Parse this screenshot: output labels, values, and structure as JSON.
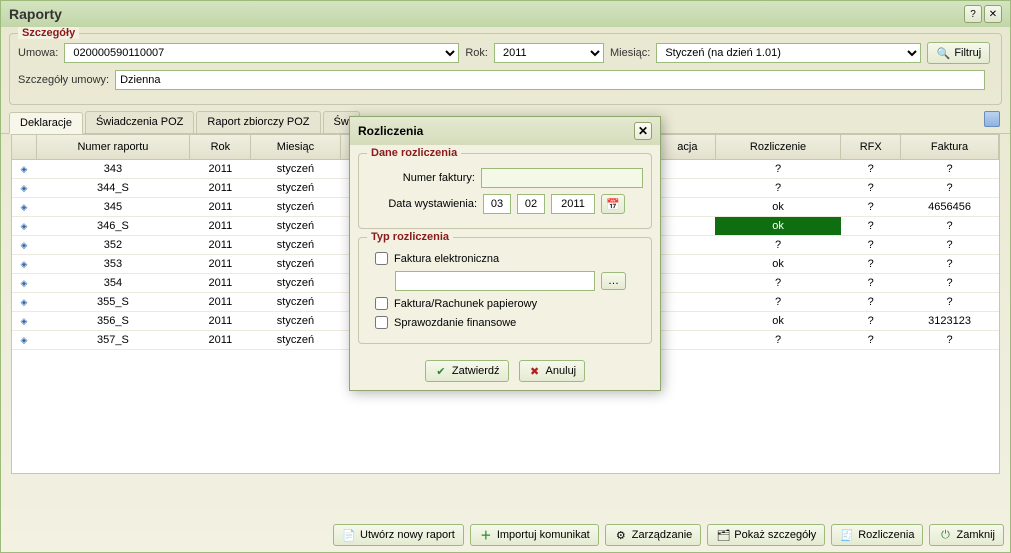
{
  "window": {
    "title": "Raporty"
  },
  "details": {
    "legend": "Szczegóły",
    "contract_label": "Umowa:",
    "contract_value": "020000590110007",
    "year_label": "Rok:",
    "year_value": "2011",
    "month_label": "Miesiąc:",
    "month_value": "Styczeń (na dzień 1.01)",
    "filter_label": "Filtruj",
    "contract_details_label": "Szczegóły umowy:",
    "contract_details_value": "Dzienna"
  },
  "tabs": [
    "Deklaracje",
    "Świadczenia POZ",
    "Raport zbiorczy POZ",
    "Św"
  ],
  "grid": {
    "columns": [
      "",
      "Numer raportu",
      "Rok",
      "Miesiąc",
      "acja",
      "Rozliczenie",
      "RFX",
      "Faktura"
    ],
    "rows": [
      {
        "num": "343",
        "rok": "2011",
        "miesiac": "styczeń",
        "acja": "",
        "roz": "?",
        "roz_hl": false,
        "rfx": "?",
        "faktura": "?"
      },
      {
        "num": "344_S",
        "rok": "2011",
        "miesiac": "styczeń",
        "acja": "",
        "roz": "?",
        "roz_hl": false,
        "rfx": "?",
        "faktura": "?"
      },
      {
        "num": "345",
        "rok": "2011",
        "miesiac": "styczeń",
        "acja": "",
        "roz": "ok",
        "roz_hl": false,
        "rfx": "?",
        "faktura": "4656456"
      },
      {
        "num": "346_S",
        "rok": "2011",
        "miesiac": "styczeń",
        "acja": "",
        "roz": "ok",
        "roz_hl": true,
        "rfx": "?",
        "faktura": "?"
      },
      {
        "num": "352",
        "rok": "2011",
        "miesiac": "styczeń",
        "acja": "",
        "roz": "?",
        "roz_hl": false,
        "rfx": "?",
        "faktura": "?"
      },
      {
        "num": "353",
        "rok": "2011",
        "miesiac": "styczeń",
        "acja": "",
        "roz": "ok",
        "roz_hl": false,
        "rfx": "?",
        "faktura": "?"
      },
      {
        "num": "354",
        "rok": "2011",
        "miesiac": "styczeń",
        "acja": "",
        "roz": "?",
        "roz_hl": false,
        "rfx": "?",
        "faktura": "?"
      },
      {
        "num": "355_S",
        "rok": "2011",
        "miesiac": "styczeń",
        "acja": "",
        "roz": "?",
        "roz_hl": false,
        "rfx": "?",
        "faktura": "?"
      },
      {
        "num": "356_S",
        "rok": "2011",
        "miesiac": "styczeń",
        "acja": "",
        "roz": "ok",
        "roz_hl": false,
        "rfx": "?",
        "faktura": "3123123"
      },
      {
        "num": "357_S",
        "rok": "2011",
        "miesiac": "styczeń",
        "acja": "",
        "roz": "?",
        "roz_hl": false,
        "rfx": "?",
        "faktura": "?"
      }
    ]
  },
  "footer": {
    "create": "Utwórz nowy raport",
    "import": "Importuj komunikat",
    "manage": "Zarządzanie",
    "show": "Pokaż szczegóły",
    "settle": "Rozliczenia",
    "close": "Zamknij"
  },
  "dialog": {
    "title": "Rozliczenia",
    "sec1": "Dane rozliczenia",
    "invoice_label": "Numer faktury:",
    "invoice_value": "",
    "date_label": "Data wystawienia:",
    "date_d": "03",
    "date_m": "02",
    "date_y": "2011",
    "sec2": "Typ rozliczenia",
    "chk1": "Faktura elektroniczna",
    "chk2": "Faktura/Rachunek papierowy",
    "chk3": "Sprawozdanie finansowe",
    "confirm": "Zatwierdź",
    "cancel": "Anuluj"
  }
}
